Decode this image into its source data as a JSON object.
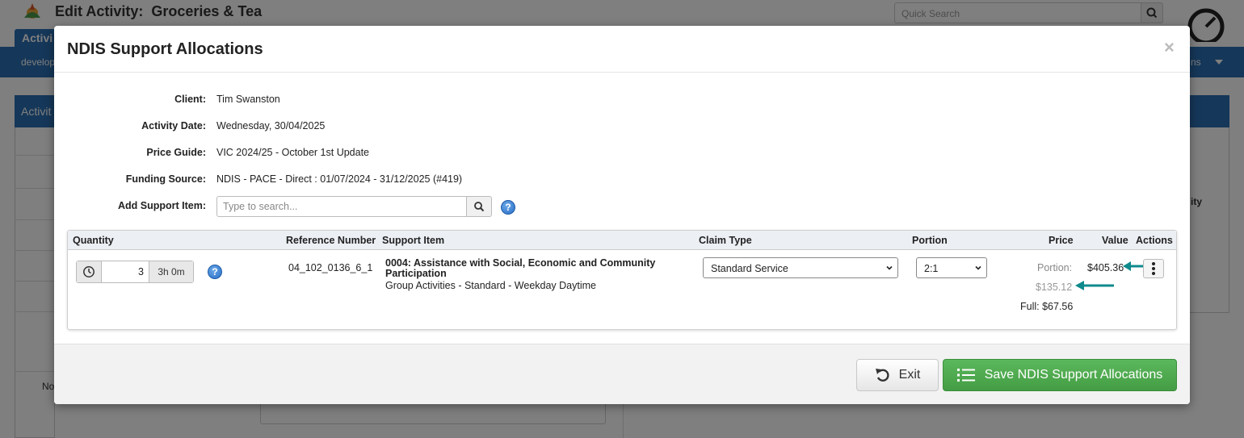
{
  "background": {
    "page_title_prefix": "Edit Activity:",
    "page_title_name": "Groceries & Tea",
    "search_placeholder": "Quick Search",
    "tab_label": "Activi",
    "nav_left": "develop",
    "nav_right": "ns",
    "panel_label": "Activit",
    "right_label": "ity",
    "bottom_label": "No"
  },
  "modal": {
    "title": "NDIS Support Allocations",
    "close_symbol": "×",
    "fields": {
      "client_label": "Client:",
      "client_value": "Tim Swanston",
      "activity_date_label": "Activity Date:",
      "activity_date_value": "Wednesday, 30/04/2025",
      "price_guide_label": "Price Guide:",
      "price_guide_value": "VIC 2024/25 - October 1st Update",
      "funding_source_label": "Funding Source:",
      "funding_source_value": "NDIS - PACE - Direct : 01/07/2024 - 31/12/2025 (#419)",
      "add_support_label": "Add Support Item:",
      "add_support_placeholder": "Type to search..."
    },
    "table": {
      "headers": {
        "quantity": "Quantity",
        "reference": "Reference Number",
        "support_item": "Support Item",
        "claim_type": "Claim Type",
        "portion": "Portion",
        "price": "Price",
        "value": "Value",
        "actions": "Actions"
      },
      "row": {
        "quantity": "3",
        "duration": "3h 0m",
        "reference": "04_102_0136_6_1",
        "support_title_line1": "0004: Assistance with Social, Economic and Community",
        "support_title_line2": "Participation",
        "support_desc": "Group Activities - Standard - Weekday Daytime",
        "claim_type": "Standard Service",
        "portion": "2:1",
        "price_portion_label": "Portion:",
        "price_portion_value": "$135.12",
        "price_full": "Full: $67.56",
        "value": "$405.36"
      }
    },
    "footer": {
      "exit_label": "Exit",
      "save_label": "Save NDIS Support Allocations"
    }
  },
  "colors": {
    "primary_blue": "#2a6fb3",
    "save_green": "#449d44",
    "annotation_arrow": "#0f8a8c"
  }
}
